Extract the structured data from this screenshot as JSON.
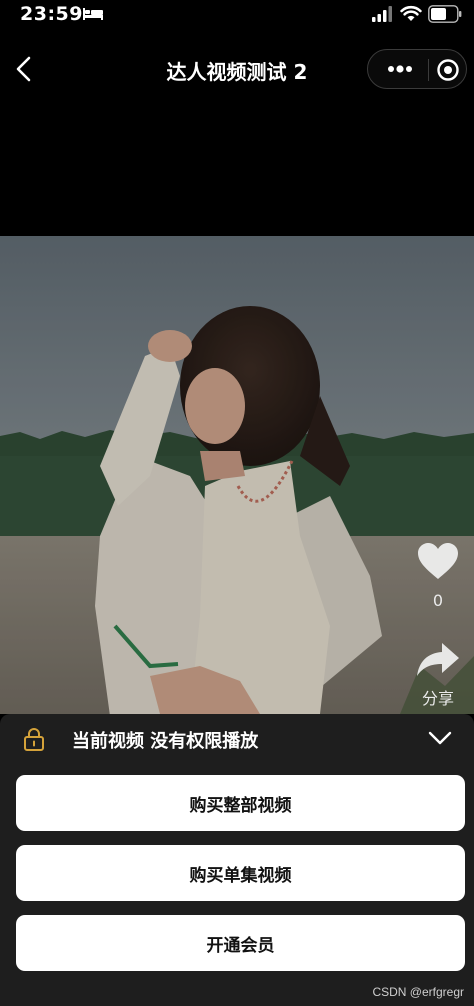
{
  "status_bar": {
    "time": "23:59",
    "icons": [
      "bed-icon",
      "cellular-signal-icon",
      "wifi-icon",
      "battery-icon"
    ]
  },
  "nav": {
    "title": "达人视频测试 2",
    "back_icon": "chevron-left-icon",
    "more_icon": "more-dots-icon",
    "close_icon": "target-circle-icon"
  },
  "video": {
    "like_count": "0",
    "like_icon": "heart-icon",
    "share_label": "分享",
    "share_icon": "share-arrow-icon"
  },
  "paywall": {
    "notice": "当前视频 没有权限播放",
    "lock_icon": "lock-icon",
    "collapse_icon": "chevron-down-icon",
    "accent_color": "#d4a23a",
    "buttons": {
      "buy_all": "购买整部视频",
      "buy_single": "购买单集视频",
      "vip": "开通会员"
    }
  },
  "watermark": "CSDN @erfgregr"
}
